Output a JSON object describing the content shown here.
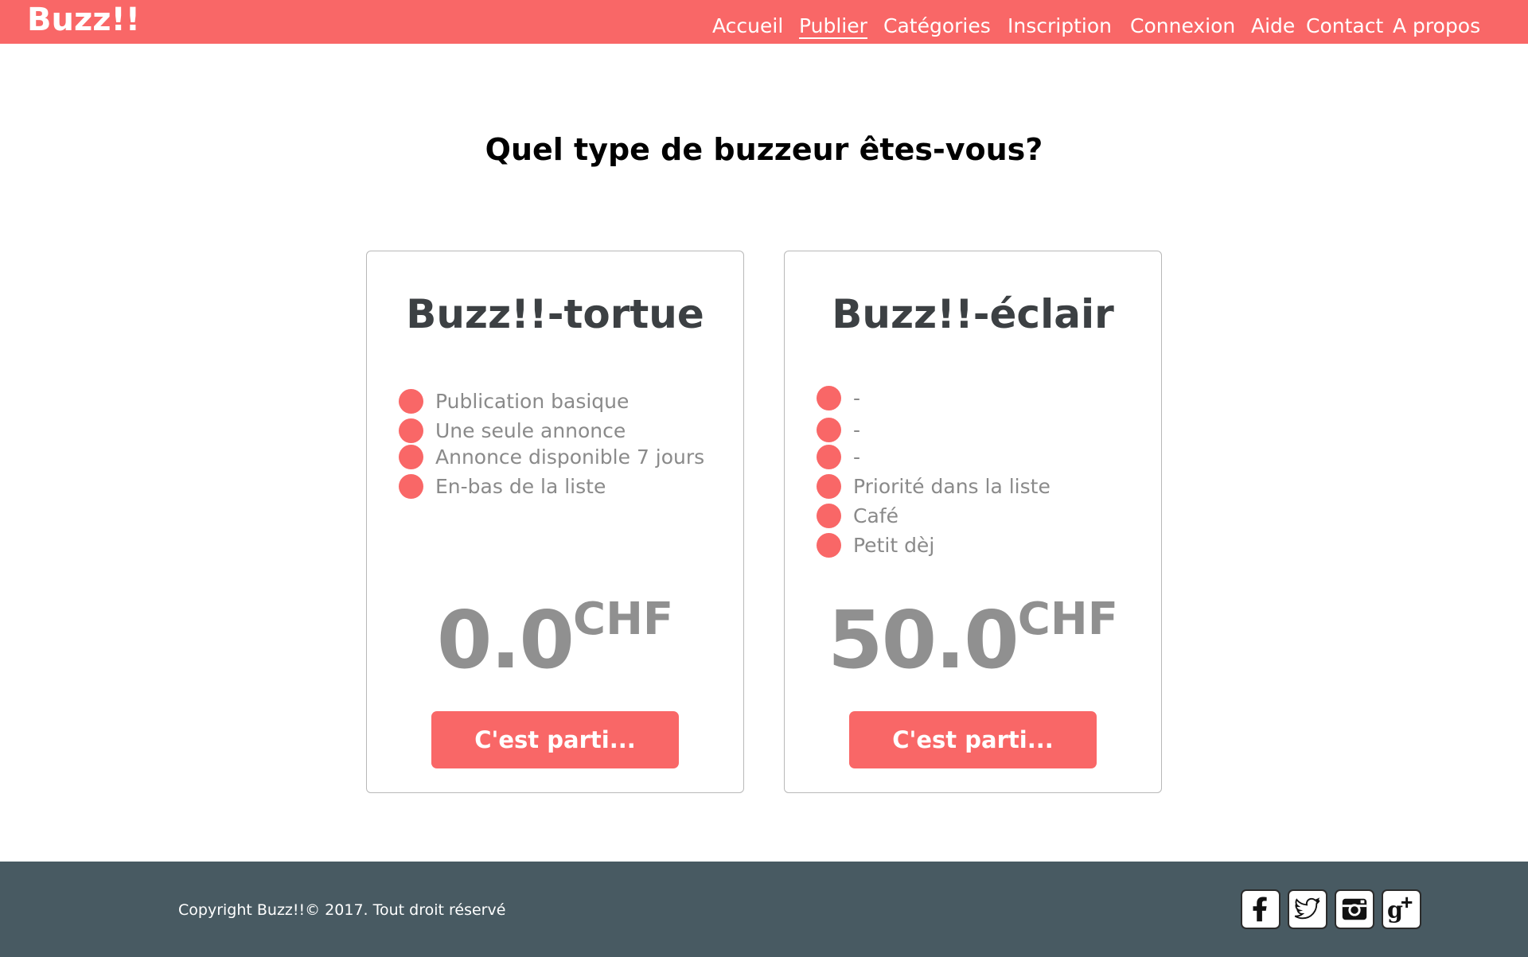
{
  "header": {
    "brand": "Buzz!!",
    "nav": [
      {
        "label": "Accueil"
      },
      {
        "label": "Publier"
      },
      {
        "label": "Catégories"
      },
      {
        "label": "Inscription"
      },
      {
        "label": "Connexion"
      },
      {
        "label": "Aide"
      },
      {
        "label": "Contact"
      },
      {
        "label": "A propos"
      }
    ],
    "active_nav": "Publier"
  },
  "main": {
    "title": "Quel type de buzzeur êtes-vous?",
    "plans": [
      {
        "name": "Buzz!!-tortue",
        "features": [
          "Publication basique",
          "Une seule annonce",
          "Annonce disponible 7 jours",
          "En-bas de la liste"
        ],
        "price": "0.0",
        "currency": "CHF",
        "cta": "C'est parti..."
      },
      {
        "name": "Buzz!!-éclair",
        "features": [
          "-",
          "-",
          "-",
          "Priorité dans la liste",
          "Café",
          "Petit dèj"
        ],
        "price": "50.0",
        "currency": "CHF",
        "cta": "C'est parti..."
      }
    ]
  },
  "footer": {
    "copyright": "Copyright Buzz!!© 2017. Tout droit réservé",
    "social": [
      "facebook-icon",
      "twitter-icon",
      "instagram-icon",
      "google-plus-icon"
    ]
  },
  "colors": {
    "accent": "#f96767",
    "footer_bg": "#485a62",
    "price_gray": "#909090",
    "title_dark": "#3c4043"
  }
}
